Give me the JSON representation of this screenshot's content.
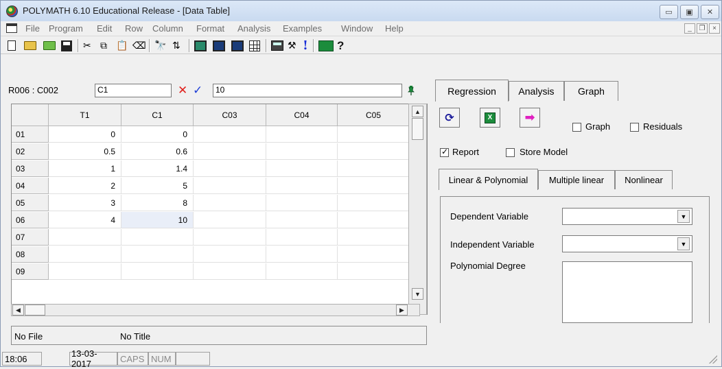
{
  "window": {
    "title": "POLYMATH 6.10 Educational Release - [Data Table]",
    "minimize": "▭",
    "maximize": "▣",
    "close": "✕"
  },
  "menu": {
    "items": [
      "File",
      "Program",
      "Edit",
      "Row",
      "Column",
      "Format",
      "Analysis",
      "Examples",
      "Window",
      "Help"
    ],
    "mdi_min": "_",
    "mdi_restore": "❐",
    "mdi_close": "×"
  },
  "toolbar": {
    "icons": [
      "new-file-icon",
      "open-folder-icon",
      "open-example-icon",
      "save-icon",
      "cut-icon",
      "copy-icon",
      "paste-icon",
      "eraser-icon",
      "find-icon",
      "sort-icon",
      "program-icon",
      "fx-icon",
      "data-icon",
      "table-icon",
      "calculator-icon",
      "wand-icon",
      "run-icon",
      "spreadsheet-icon",
      "help-icon"
    ]
  },
  "cell_editor": {
    "reference": "R006 : C002",
    "column_name": "C1",
    "value": "10"
  },
  "grid": {
    "columns": [
      "T1",
      "C1",
      "C03",
      "C04",
      "C05"
    ],
    "rows": [
      {
        "id": "01",
        "cells": [
          "0",
          "0",
          "",
          "",
          ""
        ]
      },
      {
        "id": "02",
        "cells": [
          "0.5",
          "0.6",
          "",
          "",
          ""
        ]
      },
      {
        "id": "03",
        "cells": [
          "1",
          "1.4",
          "",
          "",
          ""
        ]
      },
      {
        "id": "04",
        "cells": [
          "2",
          "5",
          "",
          "",
          ""
        ]
      },
      {
        "id": "05",
        "cells": [
          "3",
          "8",
          "",
          "",
          ""
        ]
      },
      {
        "id": "06",
        "cells": [
          "4",
          "10",
          "",
          "",
          ""
        ]
      },
      {
        "id": "07",
        "cells": [
          "",
          "",
          "",
          "",
          ""
        ]
      },
      {
        "id": "08",
        "cells": [
          "",
          "",
          "",
          "",
          ""
        ]
      },
      {
        "id": "09",
        "cells": [
          "",
          "",
          "",
          "",
          ""
        ]
      }
    ],
    "selected": {
      "row": 5,
      "col": 1
    }
  },
  "file_info": {
    "file": "No File",
    "title": "No Title"
  },
  "right_panel": {
    "tabs": [
      "Regression",
      "Analysis",
      "Graph"
    ],
    "active_tab": "Regression",
    "options": {
      "graph_label": "Graph",
      "graph_checked": false,
      "residuals_label": "Residuals",
      "residuals_checked": false,
      "report_label": "Report",
      "report_checked": true,
      "store_model_label": "Store Model",
      "store_model_checked": false
    },
    "subtabs": [
      "Linear & Polynomial",
      "Multiple linear",
      "Nonlinear"
    ],
    "active_subtab": "Linear & Polynomial",
    "form": {
      "dependent_label": "Dependent Variable",
      "dependent_value": "",
      "independent_label": "Independent Variable",
      "independent_value": "",
      "degree_label": "Polynomial Degree"
    }
  },
  "status": {
    "time": "18:06",
    "date": "13-03-2017",
    "caps": "CAPS",
    "num": "NUM"
  }
}
